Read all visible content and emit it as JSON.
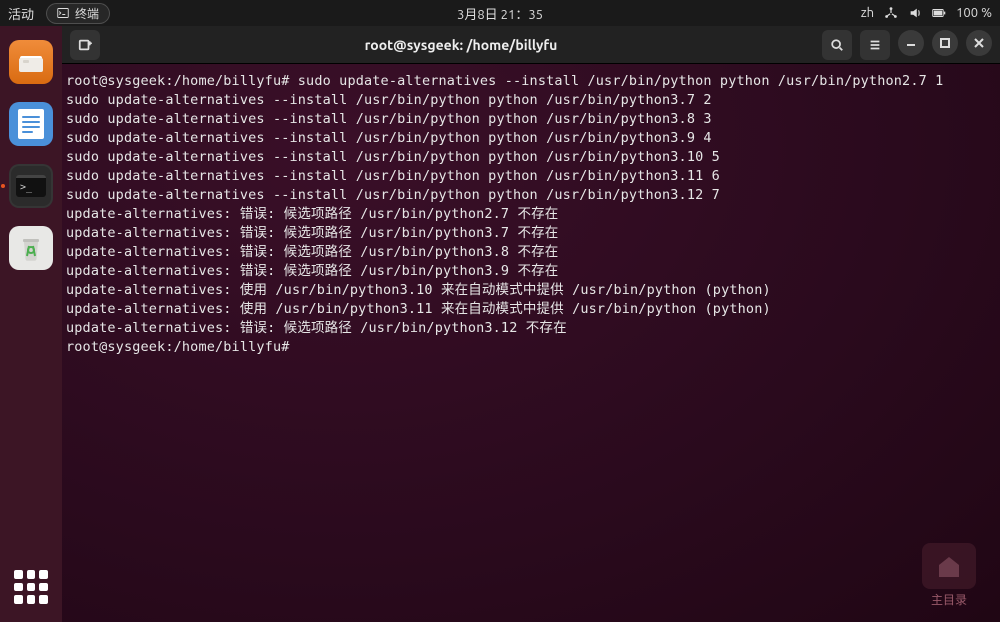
{
  "topbar": {
    "activities": "活动",
    "app_name": "终端",
    "datetime": "3月8日  21：35",
    "input_method": "zh",
    "battery": "100 %"
  },
  "titlebar": {
    "title": "root@sysgeek: /home/billyfu"
  },
  "terminal": {
    "prompt": "root@sysgeek:/home/billyfu#",
    "lines": [
      "root@sysgeek:/home/billyfu# sudo update-alternatives --install /usr/bin/python python /usr/bin/python2.7 1",
      "sudo update-alternatives --install /usr/bin/python python /usr/bin/python3.7 2",
      "sudo update-alternatives --install /usr/bin/python python /usr/bin/python3.8 3",
      "sudo update-alternatives --install /usr/bin/python python /usr/bin/python3.9 4",
      "sudo update-alternatives --install /usr/bin/python python /usr/bin/python3.10 5",
      "sudo update-alternatives --install /usr/bin/python python /usr/bin/python3.11 6",
      "sudo update-alternatives --install /usr/bin/python python /usr/bin/python3.12 7",
      "update-alternatives: 错误: 候选项路径 /usr/bin/python2.7 不存在",
      "update-alternatives: 错误: 候选项路径 /usr/bin/python3.7 不存在",
      "update-alternatives: 错误: 候选项路径 /usr/bin/python3.8 不存在",
      "update-alternatives: 错误: 候选项路径 /usr/bin/python3.9 不存在",
      "update-alternatives: 使用 /usr/bin/python3.10 来在自动模式中提供 /usr/bin/python (python)",
      "update-alternatives: 使用 /usr/bin/python3.11 来在自动模式中提供 /usr/bin/python (python)",
      "update-alternatives: 错误: 候选项路径 /usr/bin/python3.12 不存在",
      "root@sysgeek:/home/billyfu#"
    ]
  },
  "desktop": {
    "home_label": "主目录"
  }
}
